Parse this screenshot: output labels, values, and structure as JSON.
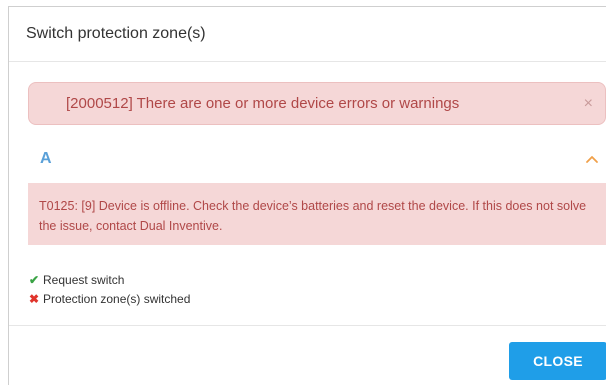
{
  "dialog": {
    "title": "Switch protection zone(s)"
  },
  "alert": {
    "message": "[2000512] There are one or more device errors or warnings",
    "close_icon": "×"
  },
  "section": {
    "title": "A",
    "chevron_icon": "chevron-up-icon"
  },
  "device_alert": {
    "message": "T0125: [9] Device is offline. Check the device’s batteries and reset the device. If this does not solve the issue, contact Dual Inventive."
  },
  "status": {
    "items": [
      {
        "icon": "✔",
        "icon_name": "check-icon",
        "label": "Request switch",
        "state": "success"
      },
      {
        "icon": "✖",
        "icon_name": "cross-icon",
        "label": "Protection zone(s) switched",
        "state": "failed"
      }
    ]
  },
  "footer": {
    "close_label": "CLOSE"
  },
  "colors": {
    "accent": "#1f9ee8",
    "alert_bg": "#f5d7d7",
    "alert_text": "#b04848",
    "section_title": "#5aa0d8",
    "chevron": "#f0a04a",
    "success": "#3aa345",
    "error": "#e0342c"
  }
}
